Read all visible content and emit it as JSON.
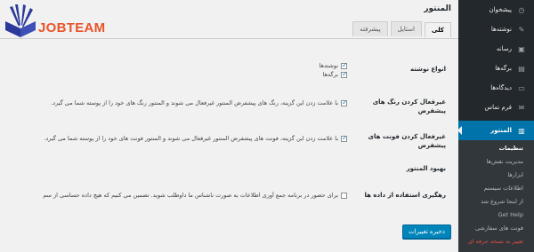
{
  "logo": {
    "text": "JOBTEAM",
    "color": "#e8542a",
    "book_color": "#2b3a9a"
  },
  "page": {
    "title": "المنتور"
  },
  "tabs": [
    {
      "label": "کلی",
      "active": true
    },
    {
      "label": "استایل",
      "active": false
    },
    {
      "label": "پیشرفته",
      "active": false
    }
  ],
  "settings": {
    "post_types": {
      "label": "انواع نوشته",
      "options": [
        {
          "label": "نوشته‌ها",
          "checked": true
        },
        {
          "label": "برگه‌ها",
          "checked": true
        }
      ]
    },
    "default_colors": {
      "label": "غیرفعال کردن رنگ های پیشفرض",
      "checked": true,
      "description": "با علامت زدن این گزینه، رنگ های پیشفرض المنتور غیرفعال می شوند و المنتور رنگ های خود را از پوسته شما می گیرد."
    },
    "default_fonts": {
      "label": "غیرفعال کردن فونت های پیشفرض",
      "checked": true,
      "description": "با علامت زدن این گزینه، فونت های پیشفرض المنتور غیرفعال می شوند و المنتور فونت های خود را از پوسته شما می گیرد."
    },
    "improve": {
      "label": "بهبود المنتور"
    },
    "usage_tracking": {
      "label": "رهگیری استفاده از داده ها",
      "checked": false,
      "description": "برای حضور در برنامه جمع آوری اطلاعات به صورت ناشناس ما داوطلب شوید. تضمین می کنیم که هیچ داده حساسی از سم"
    }
  },
  "save_button": {
    "label": "ذخیره تغییرات"
  },
  "sidebar": {
    "items": [
      {
        "label": "پیشخوان",
        "icon": "dashboard-icon",
        "glyph": "◷"
      },
      {
        "label": "نوشته‌ها",
        "icon": "pin-icon",
        "glyph": "✎"
      },
      {
        "label": "رسانه",
        "icon": "media-icon",
        "glyph": "▣"
      },
      {
        "label": "برگه‌ها",
        "icon": "pages-icon",
        "glyph": "▤"
      },
      {
        "label": "دیدگاه‌ها",
        "icon": "comments-icon",
        "glyph": "▭"
      },
      {
        "label": "فرم تماس",
        "icon": "mail-icon",
        "glyph": "✉"
      }
    ],
    "active": {
      "label": "المنتور",
      "icon": "elementor-icon",
      "glyph": "▥"
    },
    "submenu": [
      {
        "label": "تنظیمات",
        "current": true
      },
      {
        "label": "مدیریت نقش‌ها"
      },
      {
        "label": "ابزارها"
      },
      {
        "label": "اطلاعات سیستم"
      },
      {
        "label": "از اینجا شروع شد"
      },
      {
        "label": "Get Help"
      },
      {
        "label": "فونت های سفارشی"
      },
      {
        "label": "تغییر به نسخه حرفه ای",
        "danger": true
      }
    ]
  }
}
